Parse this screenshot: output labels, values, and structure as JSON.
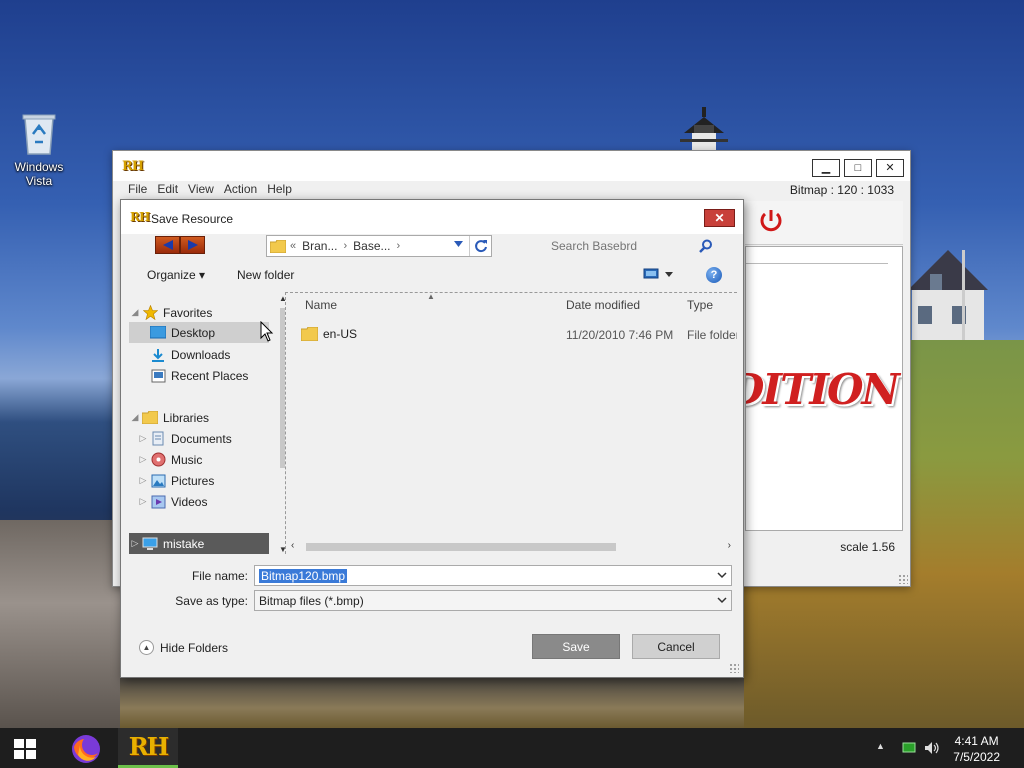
{
  "desktop": {
    "recycle_bin_label": "Windows Vista"
  },
  "app": {
    "logo_text": "RH",
    "menu": [
      "File",
      "Edit",
      "View",
      "Action",
      "Help"
    ],
    "bitmap_info": "Bitmap : 120 : 1033",
    "canvas_text": "DITION",
    "scale": "scale 1.56",
    "window_buttons": {
      "minimize": "▁",
      "maximize": "□",
      "close": "✕"
    }
  },
  "dialog": {
    "logo_text": "RH",
    "title": "Save Resource",
    "close_glyph": "✕",
    "address": {
      "crumb_prefix": "«",
      "crumbs": [
        "Bran...",
        "Base..."
      ],
      "separator": "›"
    },
    "search_placeholder": "Search Basebrd",
    "toolbar": {
      "organize": "Organize ▾",
      "new_folder": "New folder",
      "help": "?"
    },
    "nav": {
      "favorites": "Favorites",
      "desktop": "Desktop",
      "downloads": "Downloads",
      "recent_places": "Recent Places",
      "libraries": "Libraries",
      "documents": "Documents",
      "music": "Music",
      "pictures": "Pictures",
      "videos": "Videos",
      "computer": "mistake"
    },
    "columns": {
      "name": "Name",
      "date_modified": "Date modified",
      "type": "Type"
    },
    "files": [
      {
        "name": "en-US",
        "date": "11/20/2010 7:46 PM",
        "type": "File folder"
      }
    ],
    "file_name_label": "File name:",
    "file_name_value": "Bitmap120.bmp",
    "save_as_type_label": "Save as type:",
    "save_as_type_value": "Bitmap files (*.bmp)",
    "hide_folders": "Hide Folders",
    "save_button": "Save",
    "cancel_button": "Cancel"
  },
  "taskbar": {
    "rh_label": "RH",
    "time": "4:41 AM",
    "date": "7/5/2022"
  }
}
